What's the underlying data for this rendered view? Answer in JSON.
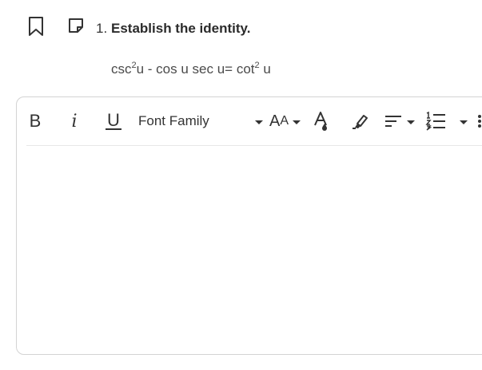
{
  "question": {
    "number": "1.",
    "title": "Establish the identity.",
    "formula": {
      "p1": "csc",
      "sup1": "2",
      "p2": "u - cos u sec u= cot",
      "sup2": "2",
      "p3": " u"
    }
  },
  "toolbar": {
    "bold": "B",
    "italic": "i",
    "underline": "U",
    "font_family": "Font Family",
    "font_size_big": "A",
    "font_size_small": "A"
  },
  "icons": {
    "bookmark": "bookmark-icon",
    "note": "note-icon",
    "font_color": "font-color-icon",
    "highlight": "highlighter-icon",
    "align": "align-left-icon",
    "list": "ordered-list-icon",
    "more": "more-vertical-icon"
  },
  "colors": {
    "text": "#2b2b2b",
    "border": "#d3d3d3"
  }
}
